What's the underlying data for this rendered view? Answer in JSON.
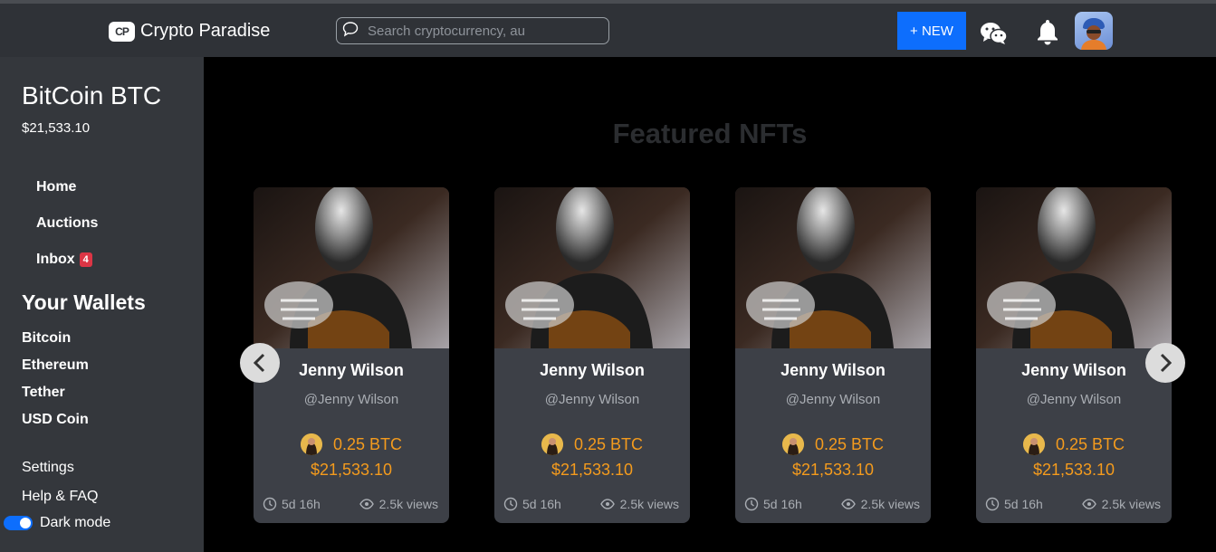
{
  "header": {
    "logo_badge": "CP",
    "app_title": "Crypto Paradise",
    "search_placeholder": "Search cryptocurrency, au",
    "new_button": "+ NEW"
  },
  "sidebar": {
    "coin_title": "BitCoin BTC",
    "coin_price": "$21,533.10",
    "nav": [
      {
        "label": "Home"
      },
      {
        "label": "Auctions"
      },
      {
        "label": "Inbox",
        "badge": "4"
      }
    ],
    "wallets_title": "Your Wallets",
    "wallets": [
      "Bitcoin",
      "Ethereum",
      "Tether",
      "USD Coin"
    ],
    "settings": "Settings",
    "help": "Help & FAQ",
    "dark_mode": "Dark mode"
  },
  "main": {
    "title": "Featured NFTs",
    "cards": [
      {
        "name": "Jenny Wilson",
        "handle": "@Jenny Wilson",
        "btc": "0.25 BTC",
        "usd": "$21,533.10",
        "time": "5d 16h",
        "views": "2.5k views"
      },
      {
        "name": "Jenny Wilson",
        "handle": "@Jenny Wilson",
        "btc": "0.25 BTC",
        "usd": "$21,533.10",
        "time": "5d 16h",
        "views": "2.5k views"
      },
      {
        "name": "Jenny Wilson",
        "handle": "@Jenny Wilson",
        "btc": "0.25 BTC",
        "usd": "$21,533.10",
        "time": "5d 16h",
        "views": "2.5k views"
      },
      {
        "name": "Jenny Wilson",
        "handle": "@Jenny Wilson",
        "btc": "0.25 BTC",
        "usd": "$21,533.10",
        "time": "5d 16h",
        "views": "2.5k views"
      }
    ]
  },
  "colors": {
    "accent": "#0d6efd",
    "price": "#f49b1d",
    "badge": "#dc3545"
  },
  "icons": [
    "chat-bubble-icon",
    "wechat-icon",
    "bell-icon",
    "clock-icon",
    "eye-icon",
    "chevron-left-icon",
    "chevron-right-icon"
  ]
}
